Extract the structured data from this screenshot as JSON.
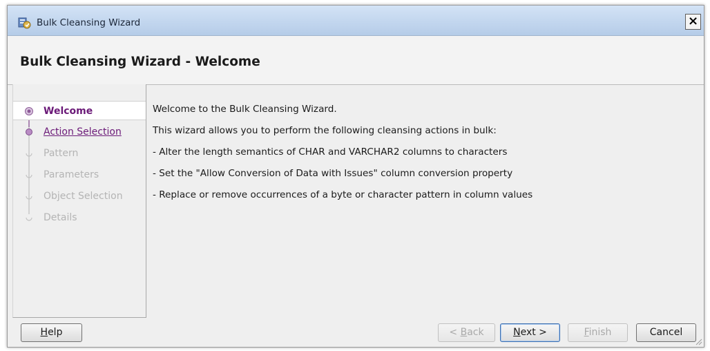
{
  "window": {
    "title": "Bulk Cleansing Wizard",
    "close_glyph": "×"
  },
  "header": {
    "title": "Bulk Cleansing Wizard - Welcome"
  },
  "nav": {
    "steps": [
      {
        "label": "Welcome",
        "state": "current"
      },
      {
        "label": "Action Selection",
        "state": "link"
      },
      {
        "label": "Pattern",
        "state": "disabled"
      },
      {
        "label": "Parameters",
        "state": "disabled"
      },
      {
        "label": "Object Selection",
        "state": "disabled"
      },
      {
        "label": "Details",
        "state": "disabled"
      }
    ]
  },
  "content": {
    "lines": [
      "Welcome to the Bulk Cleansing Wizard.",
      "This wizard allows you to perform the following cleansing actions in bulk:",
      "- Alter the length semantics of CHAR and VARCHAR2 columns to characters",
      "- Set the \"Allow Conversion of Data with Issues\" column conversion property",
      "- Replace or remove occurrences of a byte or character pattern in column values"
    ]
  },
  "buttons": {
    "help": {
      "mnemonic": "H",
      "rest": "elp"
    },
    "back": {
      "prefix": "< ",
      "mnemonic": "B",
      "rest": "ack"
    },
    "next": {
      "mnemonic": "N",
      "rest": "ext >"
    },
    "finish": {
      "mnemonic": "F",
      "rest": "inish"
    },
    "cancel": "Cancel"
  },
  "colors": {
    "accent": "#6b1a78",
    "disabled_text": "#b4b4b4",
    "titlebar": "#c6d9f0"
  },
  "icons": {
    "app": "wizard-app-icon",
    "close": "close-icon",
    "step_node": "step-node-icon",
    "resize": "resize-grip-icon"
  }
}
